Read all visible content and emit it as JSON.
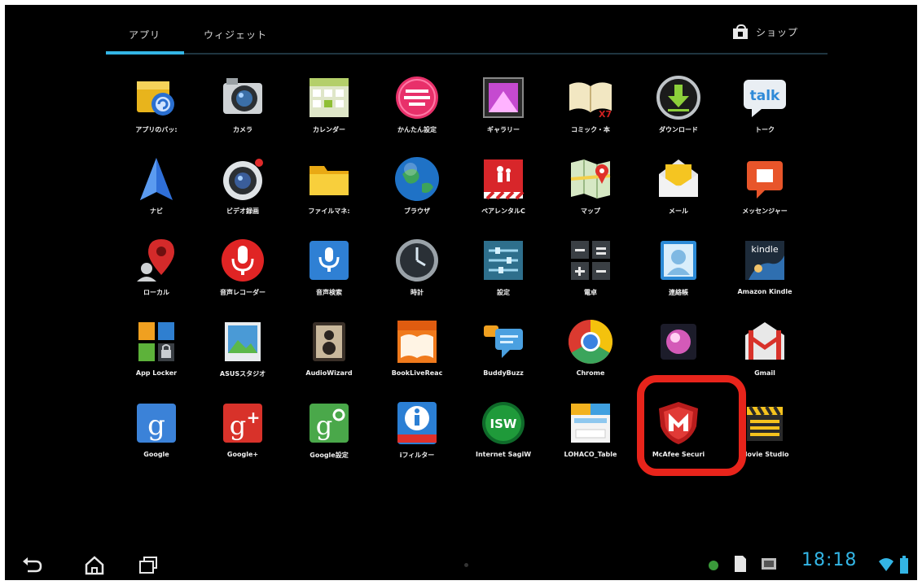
{
  "tabs": {
    "apps_label": "アプリ",
    "widgets_label": "ウィジェット",
    "shop_label": "ショップ"
  },
  "apps": [
    {
      "label": "アプリのバッ:",
      "icon": "app-backup-icon"
    },
    {
      "label": "カメラ",
      "icon": "camera-icon"
    },
    {
      "label": "カレンダー",
      "icon": "calendar-icon"
    },
    {
      "label": "かんたん設定",
      "icon": "easy-settings-icon"
    },
    {
      "label": "ギャラリー",
      "icon": "gallery-icon"
    },
    {
      "label": "コミック・本",
      "icon": "comic-book-icon"
    },
    {
      "label": "ダウンロード",
      "icon": "download-icon"
    },
    {
      "label": "トーク",
      "icon": "talk-icon"
    },
    {
      "label": "ナビ",
      "icon": "navigation-icon"
    },
    {
      "label": "ビデオ録画",
      "icon": "video-recorder-icon"
    },
    {
      "label": "ファイルマネ:",
      "icon": "file-manager-icon"
    },
    {
      "label": "ブラウザ",
      "icon": "browser-icon"
    },
    {
      "label": "ペアレンタルC",
      "icon": "parental-control-icon"
    },
    {
      "label": "マップ",
      "icon": "maps-icon"
    },
    {
      "label": "メール",
      "icon": "mail-icon"
    },
    {
      "label": "メッセンジャー",
      "icon": "messenger-icon"
    },
    {
      "label": "ローカル",
      "icon": "local-icon"
    },
    {
      "label": "音声レコーダー",
      "icon": "voice-recorder-icon"
    },
    {
      "label": "音声検索",
      "icon": "voice-search-icon"
    },
    {
      "label": "時計",
      "icon": "clock-icon"
    },
    {
      "label": "設定",
      "icon": "settings-icon"
    },
    {
      "label": "電卓",
      "icon": "calculator-icon"
    },
    {
      "label": "連絡帳",
      "icon": "contacts-icon"
    },
    {
      "label": "Amazon Kindle",
      "icon": "kindle-icon"
    },
    {
      "label": "App Locker",
      "icon": "app-locker-icon"
    },
    {
      "label": "ASUSスタジオ",
      "icon": "asus-studio-icon"
    },
    {
      "label": "AudioWizard",
      "icon": "audiowizard-icon"
    },
    {
      "label": "BookLiveReac",
      "icon": "booklive-icon"
    },
    {
      "label": "BuddyBuzz",
      "icon": "buddybuzz-icon"
    },
    {
      "label": "Chrome",
      "icon": "chrome-icon"
    },
    {
      "label": "",
      "icon": "orb-app-icon"
    },
    {
      "label": "Gmail",
      "icon": "gmail-icon"
    },
    {
      "label": "Google",
      "icon": "google-search-icon"
    },
    {
      "label": "Google+",
      "icon": "google-plus-icon"
    },
    {
      "label": "Google設定",
      "icon": "google-settings-icon"
    },
    {
      "label": "iフィルター",
      "icon": "i-filter-icon"
    },
    {
      "label": "Internet SagiW",
      "icon": "internet-sagiwall-icon"
    },
    {
      "label": "LOHACO_Table",
      "icon": "lohaco-icon"
    },
    {
      "label": "McAfee Securi",
      "icon": "mcafee-icon"
    },
    {
      "label": "Movie Studio",
      "icon": "movie-studio-icon"
    }
  ],
  "statusbar": {
    "time": "18:18"
  },
  "colors": {
    "accent": "#33b5e5",
    "highlight": "#e8241b"
  }
}
